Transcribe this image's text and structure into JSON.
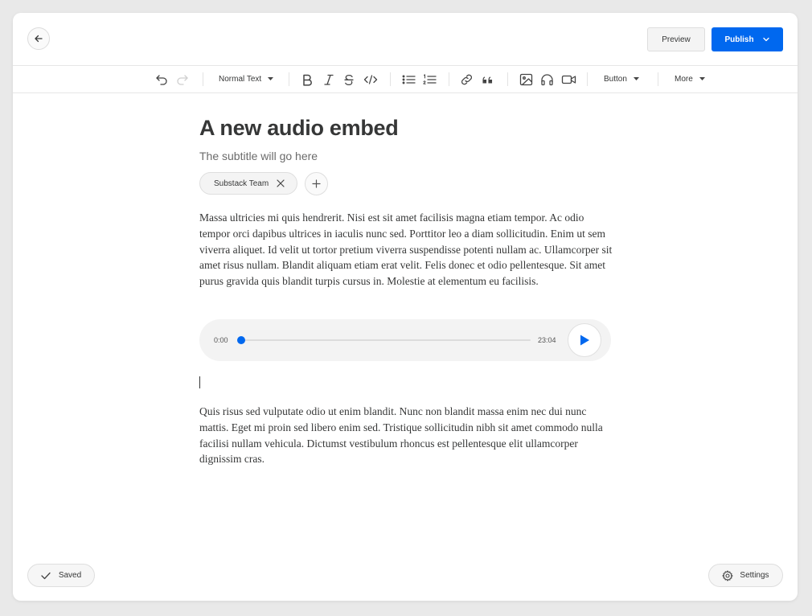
{
  "header": {
    "preview_label": "Preview",
    "publish_label": "Publish"
  },
  "toolbar": {
    "text_style": "Normal Text",
    "button_menu": "Button",
    "more_menu": "More"
  },
  "post": {
    "title": "A new audio embed",
    "subtitle": "The subtitle will go here",
    "author": "Substack Team",
    "paragraphs": [
      "Massa ultricies mi quis hendrerit. Nisi est sit amet facilisis magna etiam tempor. Ac odio tempor orci dapibus ultrices in iaculis nunc sed. Porttitor leo a diam sollicitudin. Enim ut sem viverra aliquet. Id velit ut tortor pretium viverra suspendisse potenti nullam ac. Ullamcorper sit amet risus nullam. Blandit aliquam etiam erat velit. Felis donec et odio pellentesque. Sit amet purus gravida quis blandit turpis cursus in. Molestie at elementum eu facilisis.",
      "Quis risus sed vulputate odio ut enim blandit. Nunc non blandit massa enim nec dui nunc mattis. Eget mi proin sed libero enim sed. Tristique sollicitudin nibh sit amet commodo nulla facilisi nullam vehicula. Dictumst vestibulum rhoncus est pellentesque elit ullamcorper dignissim cras."
    ]
  },
  "audio": {
    "current_time": "0:00",
    "duration": "23:04",
    "progress": 0.0
  },
  "footer": {
    "saved_label": "Saved",
    "settings_label": "Settings"
  },
  "colors": {
    "accent": "#0068ef",
    "text": "#363737"
  },
  "icons": {
    "toolbar": [
      "undo-icon",
      "redo-icon",
      "bold-icon",
      "italic-icon",
      "strikethrough-icon",
      "code-icon",
      "bullet-list-icon",
      "numbered-list-icon",
      "link-icon",
      "quote-icon",
      "image-icon",
      "audio-icon",
      "video-icon"
    ]
  }
}
